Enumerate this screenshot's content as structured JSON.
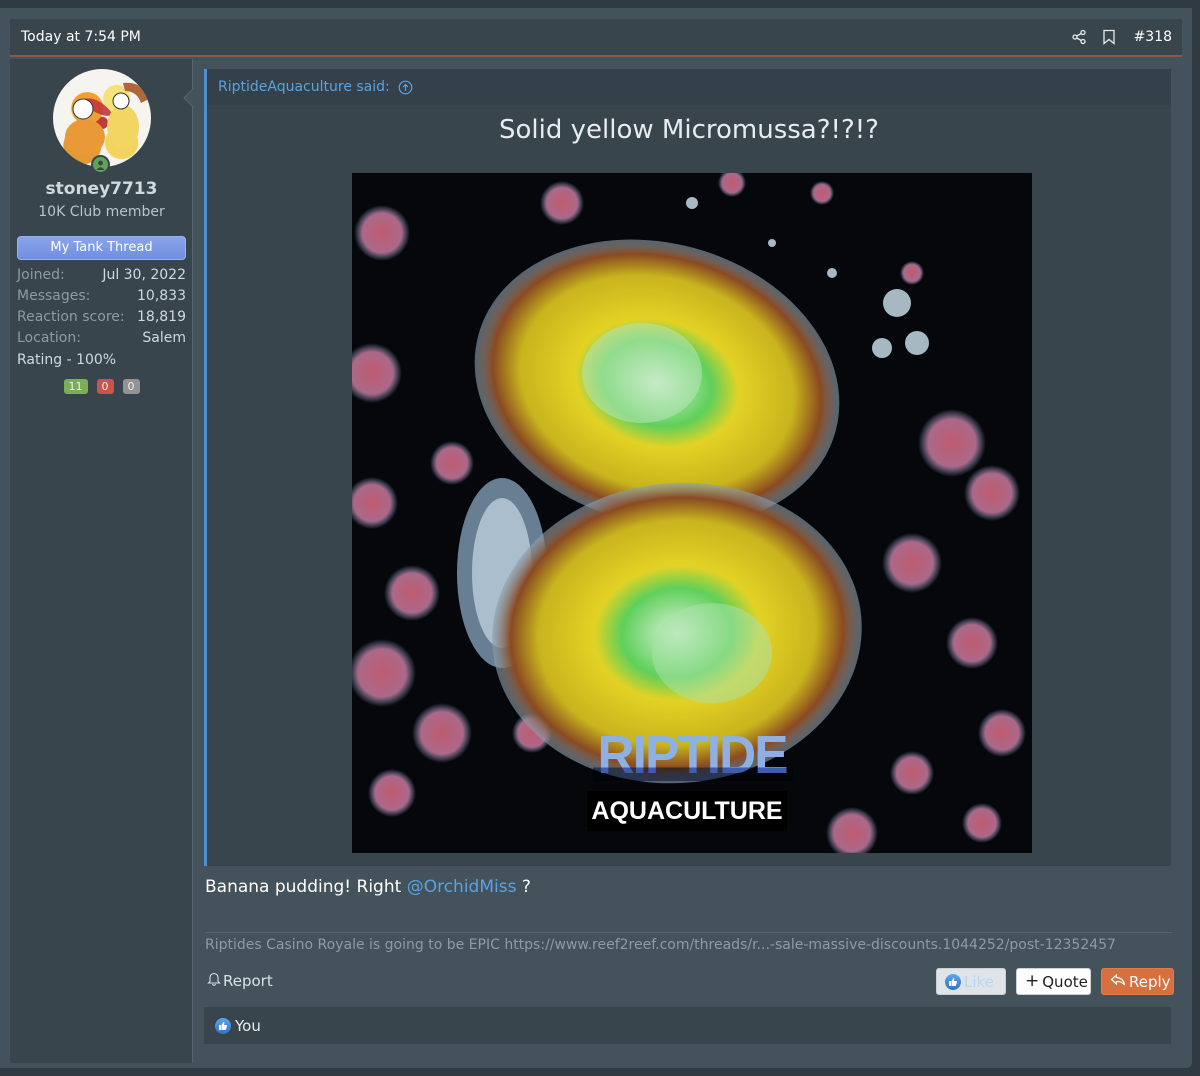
{
  "post": {
    "date": "Today at 7:54 PM",
    "post_number": "#318",
    "header_icons": [
      "share-icon",
      "bookmark-icon"
    ]
  },
  "user": {
    "username": "stoney7713",
    "title": "10K Club member",
    "banner": "My Tank Thread",
    "online": true,
    "stats": [
      {
        "key": "Joined:",
        "value": "Jul 30, 2022"
      },
      {
        "key": "Messages:",
        "value": "10,833"
      },
      {
        "key": "Reaction score:",
        "value": "18,819"
      },
      {
        "key": "Location:",
        "value": "Salem"
      }
    ],
    "rating_label": "Rating - 100%",
    "rating_badges": {
      "positive": "11",
      "negative": "0",
      "neutral": "0"
    }
  },
  "quote": {
    "author_label": "RiptideAquaculture said:",
    "title": "Solid yellow Micromussa?!?!?",
    "image": {
      "alt": "Yellow Micromussa coral photo",
      "watermark_top": "RIPTIDE",
      "watermark_bottom": "AQUACULTURE"
    }
  },
  "message": {
    "text_before": "Banana pudding! Right ",
    "mention": "@OrchidMiss",
    "text_after": " ?"
  },
  "signature": "Riptides Casino Royale is going to be EPIC https://www.reef2reef.com/threads/r...-sale-massive-discounts.1044252/post-12352457",
  "actions": {
    "report": "Report",
    "like": "Like",
    "quote": "Quote",
    "reply": "Reply"
  },
  "reactions": {
    "summary": "You"
  },
  "colors": {
    "accent_link": "#5aa2e0",
    "reply_button": "#d6703e",
    "banner": "#7b98e6",
    "header_rule": "#8a5a4a"
  }
}
